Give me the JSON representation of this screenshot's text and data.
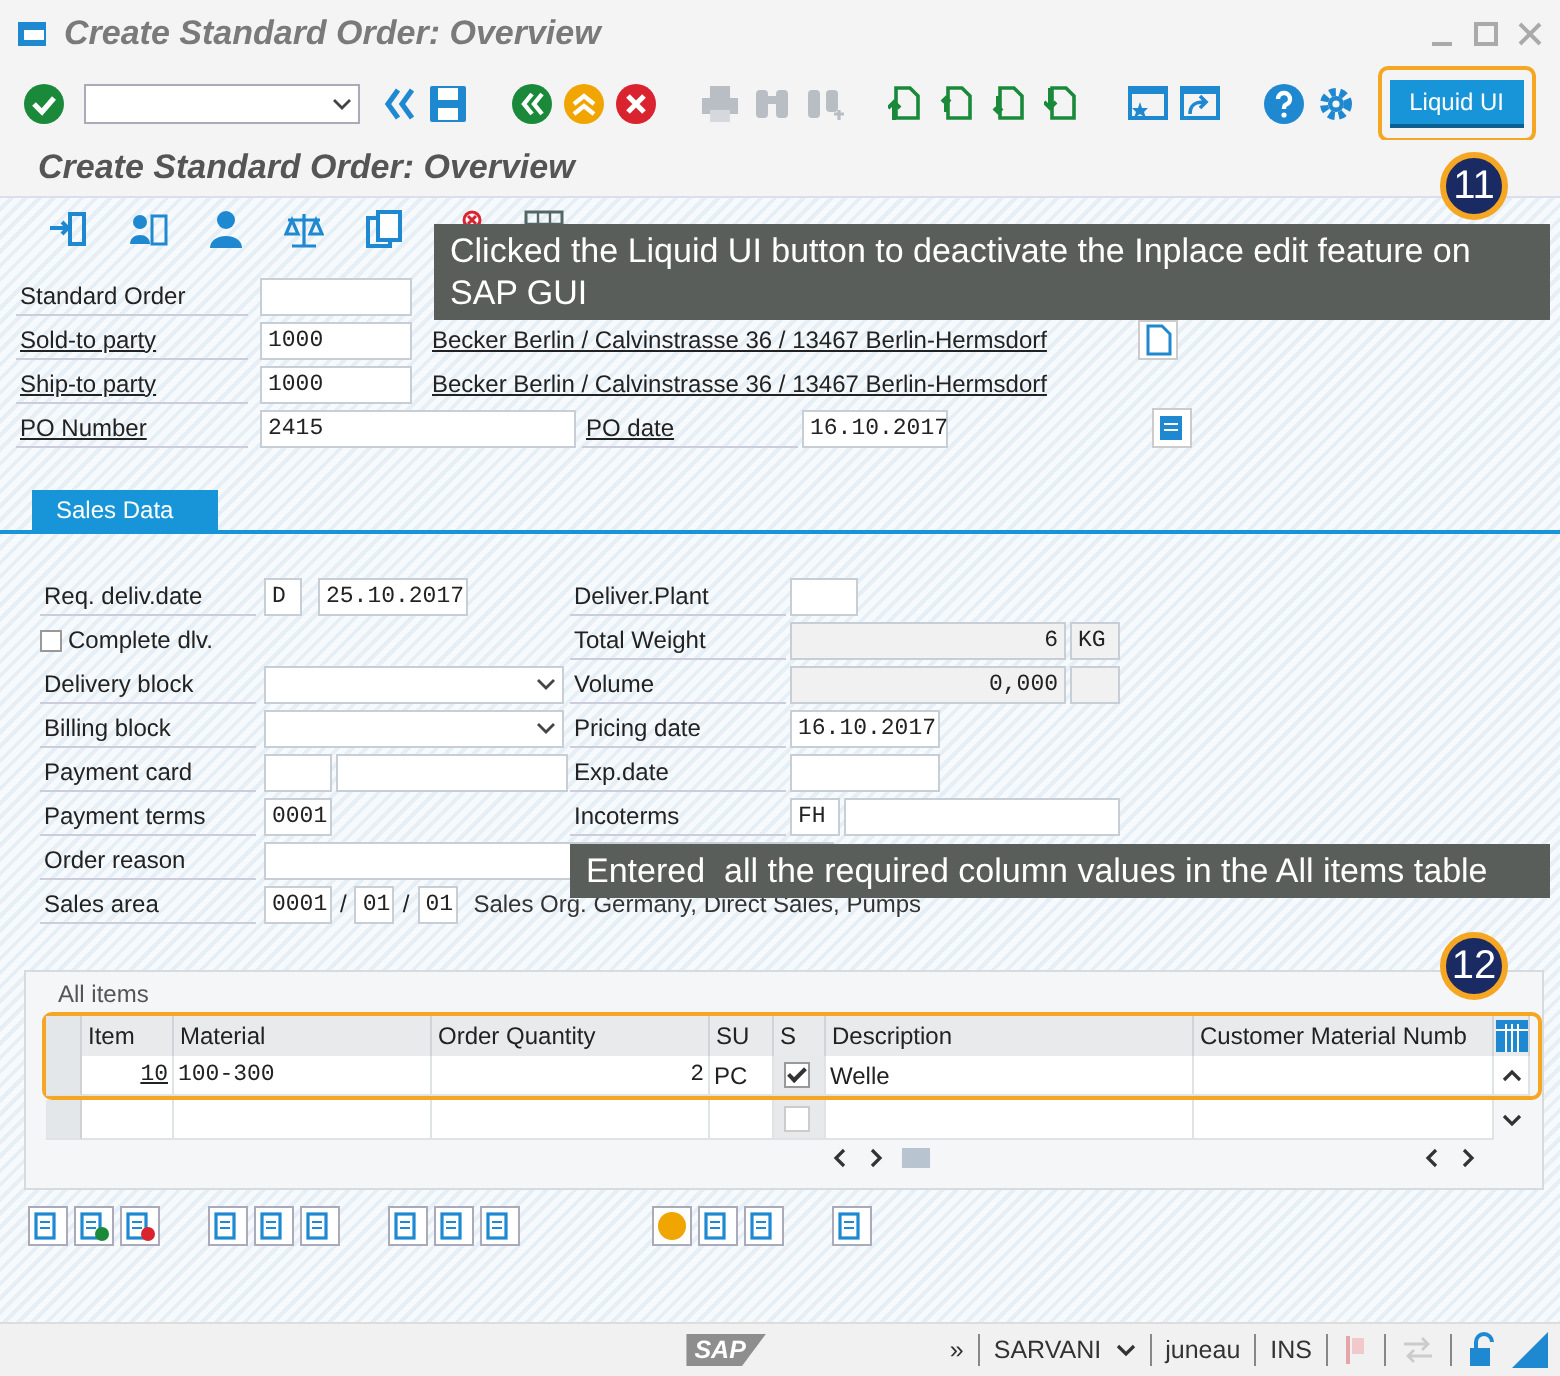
{
  "window": {
    "title": "Create Standard Order: Overview"
  },
  "toolbar": {
    "liquid_ui_button": "Liquid UI"
  },
  "screen_title": "Create Standard Order: Overview",
  "header": {
    "standard_order": {
      "label": "Standard Order",
      "link": false
    },
    "parties": [
      {
        "label": "Sold-to party",
        "link": true,
        "value": "1000",
        "description": "Becker Berlin / Calvinstrasse 36 / 13467 Berlin-Hermsdorf"
      },
      {
        "label": "Ship-to party",
        "link": true,
        "value": "1000",
        "description": "Becker Berlin / Calvinstrasse 36 / 13467 Berlin-Hermsdorf"
      }
    ],
    "po_number": {
      "label": "PO Number",
      "link": true,
      "value": "2415"
    },
    "po_date": {
      "label": "PO date",
      "link": true,
      "value": "16.10.2017"
    }
  },
  "tabs": [
    {
      "label": "Sales Data",
      "selected": true
    }
  ],
  "sales_data": {
    "left": [
      {
        "kind": "code_date",
        "label": "Req. deliv.date",
        "code": "D",
        "value": "25.10.2017"
      },
      {
        "kind": "checkbox",
        "label": "Complete dlv.",
        "checked": false
      },
      {
        "kind": "dropdown",
        "label": "Delivery block"
      },
      {
        "kind": "dropdown",
        "label": "Billing block"
      },
      {
        "kind": "pair",
        "label": "Payment card"
      },
      {
        "kind": "short",
        "label": "Payment terms",
        "value": "0001"
      }
    ],
    "right": [
      {
        "kind": "short",
        "label": "Deliver.Plant"
      },
      {
        "kind": "amount",
        "label": "Total Weight",
        "value": "6",
        "unit": "KG"
      },
      {
        "kind": "amount",
        "label": "Volume",
        "value": "0,000"
      },
      {
        "kind": "date",
        "label": "Pricing date",
        "value": "16.10.2017"
      },
      {
        "kind": "date",
        "label": "Exp.date"
      },
      {
        "kind": "incoterms",
        "label": "Incoterms",
        "value": "FH"
      }
    ],
    "order_reason": {
      "label": "Order reason"
    },
    "sales_area": {
      "label": "Sales area",
      "org": "0001",
      "sep_1": "/",
      "channel": "01",
      "sep_2": "/",
      "division": "01",
      "description": "Sales Org. Germany, Direct Sales, Pumps"
    }
  },
  "items_table": {
    "title": "All items",
    "columns": [
      "Item",
      "Material",
      "Order Quantity",
      "SU",
      "S",
      "Description",
      "Customer Material Numb"
    ],
    "rows": [
      {
        "kind": "item",
        "item": "10",
        "material": "100-300",
        "order_quantity": "2",
        "su": "PC",
        "s_checked": true,
        "description": "Welle"
      },
      {
        "kind": "empty",
        "s_checked": false
      }
    ]
  },
  "status_bar": {
    "overflow": "»",
    "logo": "SAP",
    "user": "SARVANI",
    "host": "juneau",
    "mode": "INS"
  },
  "callouts": [
    {
      "number": "11",
      "text": "Clicked the Liquid UI button to deactivate the Inplace edit feature on SAP GUI"
    },
    {
      "number": "12",
      "text": "Entered  all the required column values in the All items table"
    }
  ]
}
